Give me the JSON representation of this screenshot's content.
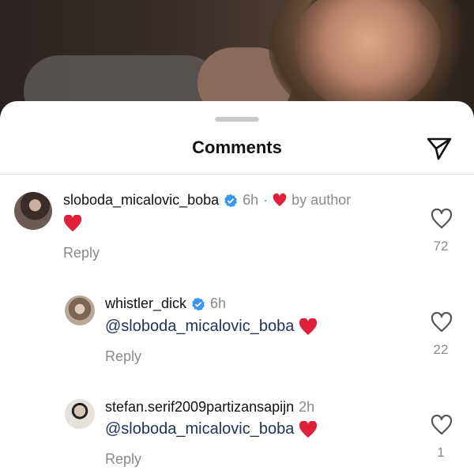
{
  "sheet": {
    "title": "Comments"
  },
  "comments": [
    {
      "username": "sloboda_micalovic_boba",
      "verified": true,
      "time": "6h",
      "separator": "·",
      "liked_by_author": "by author",
      "text": "",
      "reply_label": "Reply",
      "likes": "72"
    },
    {
      "username": "whistler_dick",
      "verified": true,
      "time": "6h",
      "mention": "@sloboda_micalovic_boba",
      "reply_label": "Reply",
      "likes": "22"
    },
    {
      "username": "stefan.serif2009partizansapijn",
      "verified": false,
      "time": "2h",
      "mention": "@sloboda_micalovic_boba",
      "reply_label": "Reply",
      "likes": "1"
    }
  ],
  "colors": {
    "heart": "#e0203a",
    "verified": "#3897f0",
    "muted": "#8a8a8a",
    "mention": "#22335a"
  },
  "icons": [
    "send-icon",
    "verified-badge-icon",
    "heart-emoji-icon",
    "heart-outline-icon"
  ]
}
